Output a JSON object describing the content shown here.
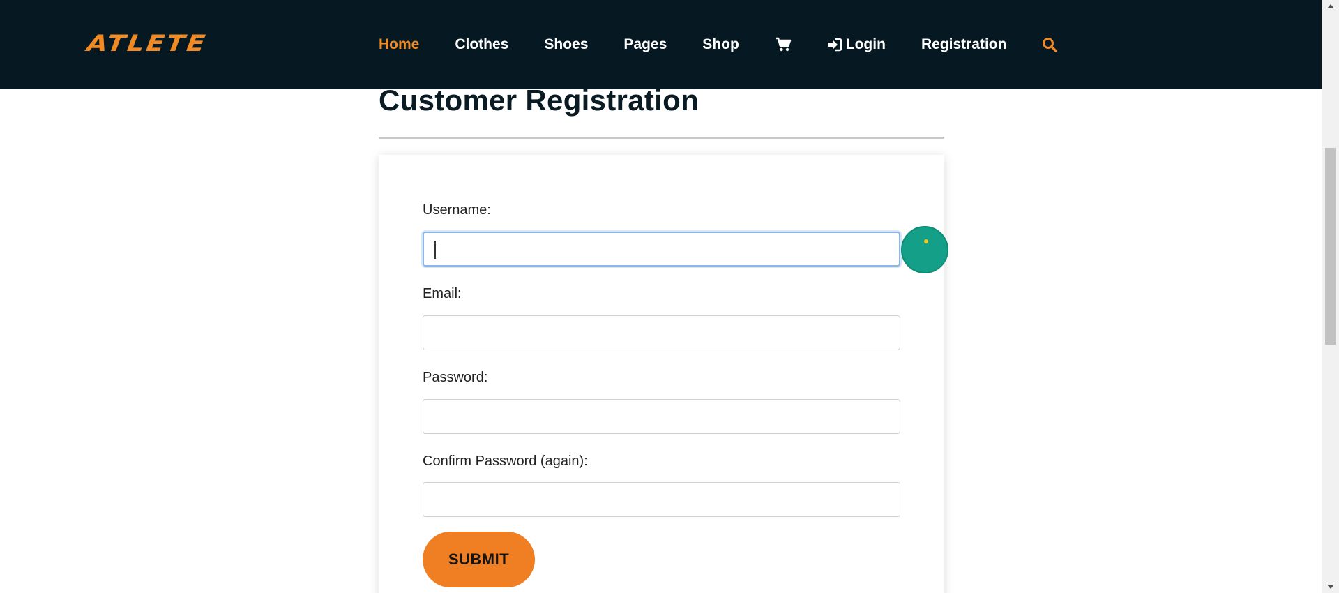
{
  "brand": {
    "logo_text": "ATLETE",
    "accent_color": "#f08a24",
    "header_bg": "#061922"
  },
  "nav": {
    "home": "Home",
    "clothes": "Clothes",
    "shoes": "Shoes",
    "pages": "Pages",
    "shop": "Shop",
    "cart_icon": "cart-icon",
    "login": "Login",
    "login_icon": "sign-in-icon",
    "registration": "Registration",
    "search_icon": "search-icon",
    "active_item": "Home"
  },
  "page": {
    "title": "Customer Registration"
  },
  "form": {
    "username_label": "Username:",
    "username_value": "",
    "email_label": "Email:",
    "email_value": "",
    "password_label": "Password:",
    "password_value": "",
    "confirm_label": "Confirm Password (again):",
    "confirm_value": "",
    "submit_label": "SUBMIT",
    "submit_color": "#f07f24"
  }
}
